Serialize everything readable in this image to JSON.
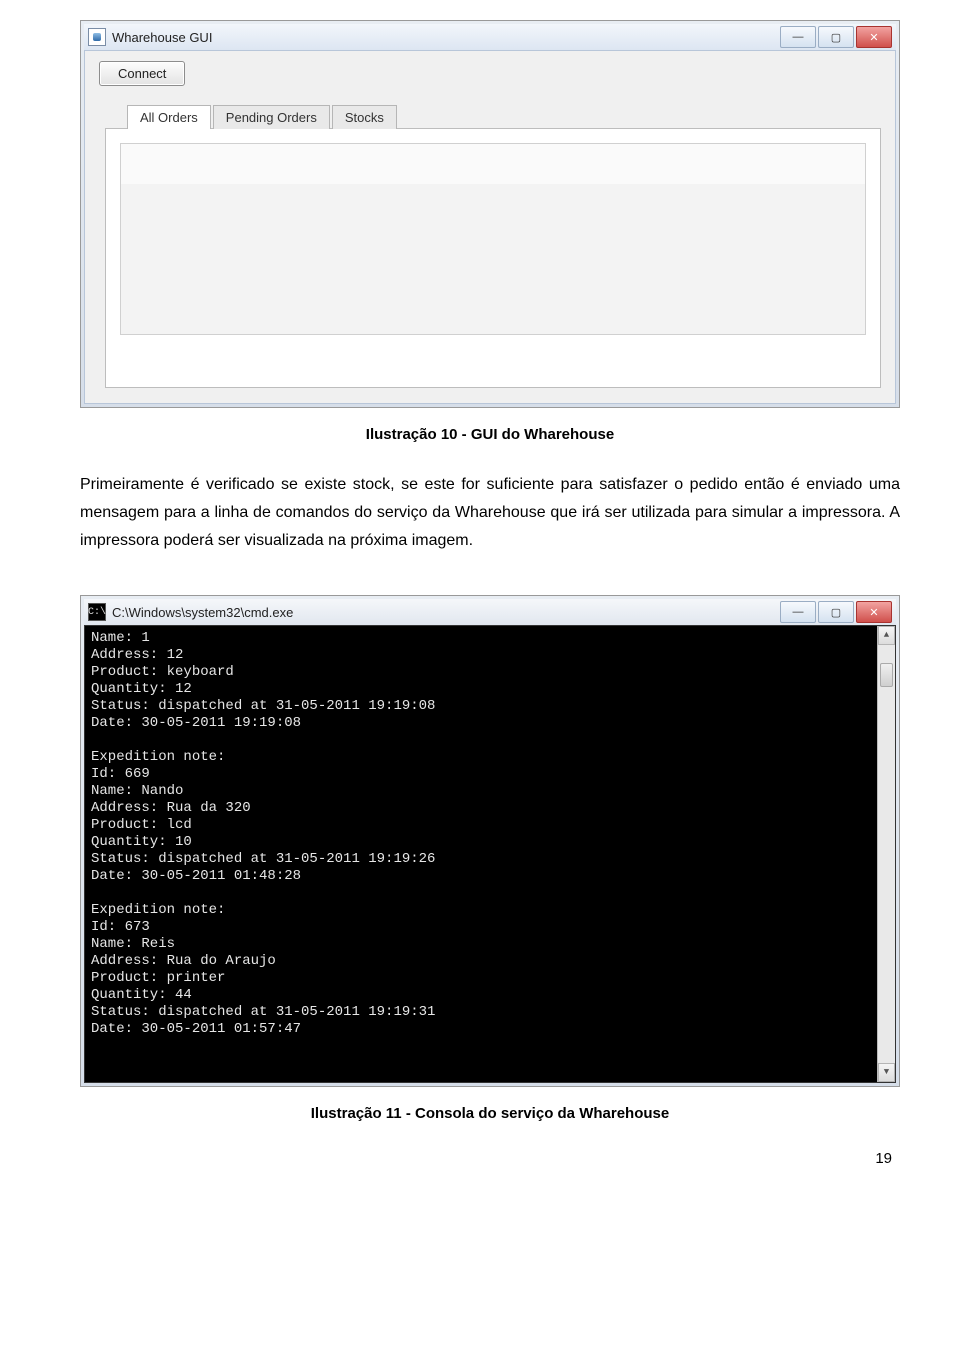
{
  "gui_window": {
    "title": "Wharehouse GUI",
    "connect_label": "Connect",
    "tabs": [
      {
        "label": "All Orders",
        "active": true
      },
      {
        "label": "Pending Orders",
        "active": false
      },
      {
        "label": "Stocks",
        "active": false
      }
    ]
  },
  "caption_1": "Ilustração 10 - GUI do Wharehouse",
  "paragraph_1": "Primeiramente é verificado se existe stock, se este for suficiente para satisfazer o pedido então é enviado uma mensagem para a linha de comandos do serviço da Wharehouse que irá ser utilizada para simular a impressora. A impressora poderá ser visualizada na próxima imagem.",
  "console_window": {
    "title": "C:\\Windows\\system32\\cmd.exe",
    "lines": [
      "Name: 1",
      "Address: 12",
      "Product: keyboard",
      "Quantity: 12",
      "Status: dispatched at 31-05-2011 19:19:08",
      "Date: 30-05-2011 19:19:08",
      "",
      "Expedition note:",
      "Id: 669",
      "Name: Nando",
      "Address: Rua da 320",
      "Product: lcd",
      "Quantity: 10",
      "Status: dispatched at 31-05-2011 19:19:26",
      "Date: 30-05-2011 01:48:28",
      "",
      "Expedition note:",
      "Id: 673",
      "Name: Reis",
      "Address: Rua do Araujo",
      "Product: printer",
      "Quantity: 44",
      "Status: dispatched at 31-05-2011 19:19:31",
      "Date: 30-05-2011 01:57:47"
    ]
  },
  "caption_2": "Ilustração 11 - Consola do serviço da Wharehouse",
  "page_number": "19"
}
